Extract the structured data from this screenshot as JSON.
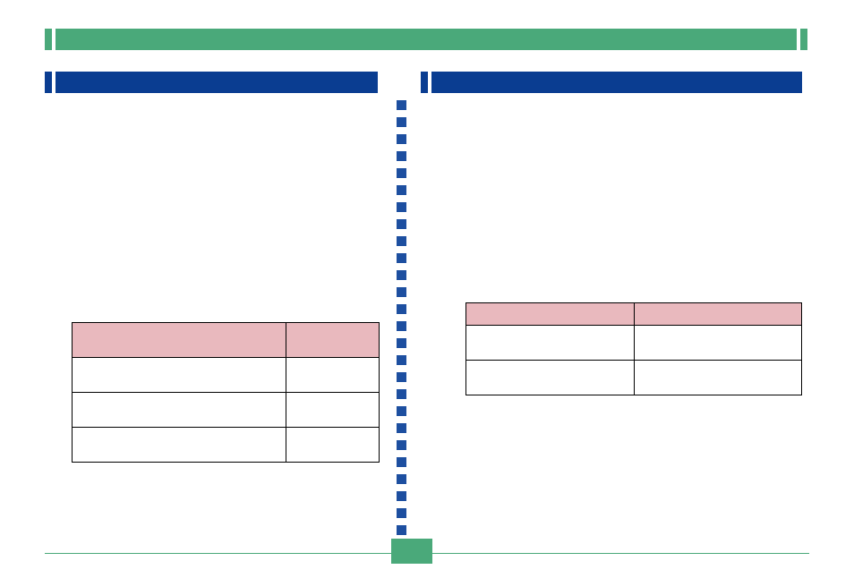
{
  "top_banner": {
    "label": ""
  },
  "left_section": {
    "heading": ""
  },
  "right_section": {
    "heading": ""
  },
  "left_table": {
    "headers": [
      "",
      ""
    ],
    "rows": [
      [
        "",
        ""
      ],
      [
        "",
        ""
      ],
      [
        "",
        ""
      ]
    ]
  },
  "right_table": {
    "headers": [
      "",
      ""
    ],
    "rows": [
      [
        "",
        ""
      ],
      [
        "",
        ""
      ]
    ]
  },
  "page_number": "",
  "colors": {
    "green": "#4aa97a",
    "blue": "#0a3d91",
    "pink": "#e9b9be"
  }
}
